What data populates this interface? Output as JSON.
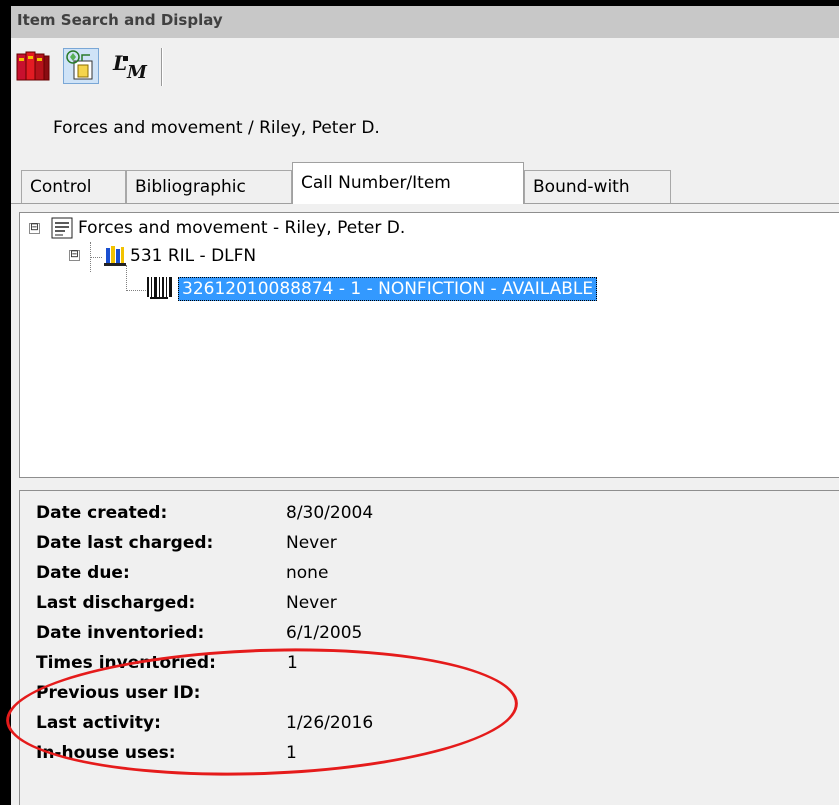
{
  "window": {
    "title": "Item Search and Display"
  },
  "toolbar": {
    "buttons": [
      {
        "name": "books-icon"
      },
      {
        "name": "tree-view-icon"
      },
      {
        "name": "user-search-icon"
      }
    ]
  },
  "record": {
    "heading": "Forces and movement / Riley, Peter D."
  },
  "tabs": [
    {
      "label": "Control",
      "active": false
    },
    {
      "label": "Bibliographic",
      "active": false
    },
    {
      "label": "Call Number/Item",
      "active": true
    },
    {
      "label": "Bound-with",
      "active": false
    }
  ],
  "tree": {
    "root": {
      "label": "Forces and movement - Riley, Peter D.",
      "expander": "⊟"
    },
    "callnumber": {
      "label": "531 RIL - DLFN",
      "expander": "⊟"
    },
    "item": {
      "label": "32612010088874 - 1 - NONFICTION - AVAILABLE"
    }
  },
  "details": [
    {
      "label": "Date created:",
      "value": "8/30/2004"
    },
    {
      "label": "Date last charged:",
      "value": "Never"
    },
    {
      "label": "Date due:",
      "value": "none"
    },
    {
      "label": "Last discharged:",
      "value": "Never"
    },
    {
      "label": "Date inventoried:",
      "value": "6/1/2005"
    },
    {
      "label": "Times inventoried:",
      "value": "1"
    },
    {
      "label": "Previous user ID:",
      "value": ""
    },
    {
      "label": "Last activity:",
      "value": "1/26/2016"
    },
    {
      "label": "In-house uses:",
      "value": "1"
    }
  ],
  "colors": {
    "selection": "#3399ff",
    "annotation_circle": "#e51b1b",
    "titlebar": "#c8c8c8"
  }
}
